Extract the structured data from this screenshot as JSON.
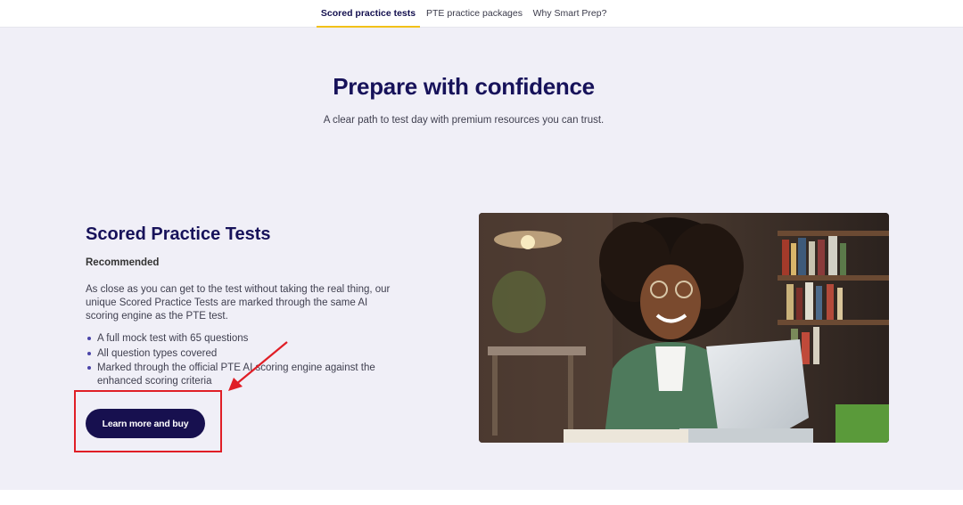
{
  "nav": {
    "tabs": [
      {
        "label": "Scored practice tests",
        "active": true
      },
      {
        "label": "PTE practice packages",
        "active": false
      },
      {
        "label": "Why Smart Prep?",
        "active": false
      }
    ]
  },
  "hero": {
    "title": "Prepare with confidence",
    "subtitle": "A clear path to test day with premium resources you can trust."
  },
  "product": {
    "title": "Scored Practice Tests",
    "badge": "Recommended",
    "description": "As close as you can get to the test without taking the real thing, our unique Scored Practice Tests are marked through the same AI scoring engine as the PTE test.",
    "features": [
      "A full mock test with 65 questions",
      "All question types covered",
      "Marked through the official PTE AI scoring engine against the enhanced scoring criteria"
    ],
    "cta_label": "Learn more and buy",
    "image_icon": "student-with-laptop-photo"
  },
  "colors": {
    "brand_navy": "#17125a",
    "accent_yellow": "#f2c118",
    "hero_bg": "#f0eff7",
    "annotation_red": "#e01e26"
  }
}
